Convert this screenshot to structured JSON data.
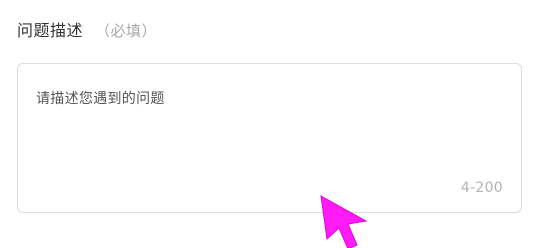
{
  "form": {
    "field_label": "问题描述",
    "required_hint": "（必填）",
    "textarea_placeholder": "请描述您遇到的问题",
    "char_count_hint": "4-200"
  },
  "cursor": {
    "icon": "mouse-pointer-icon",
    "color": "#ff1cf7"
  },
  "colors": {
    "border": "#dddddd",
    "label_text": "#333333",
    "hint_text": "#a9a9a9"
  }
}
